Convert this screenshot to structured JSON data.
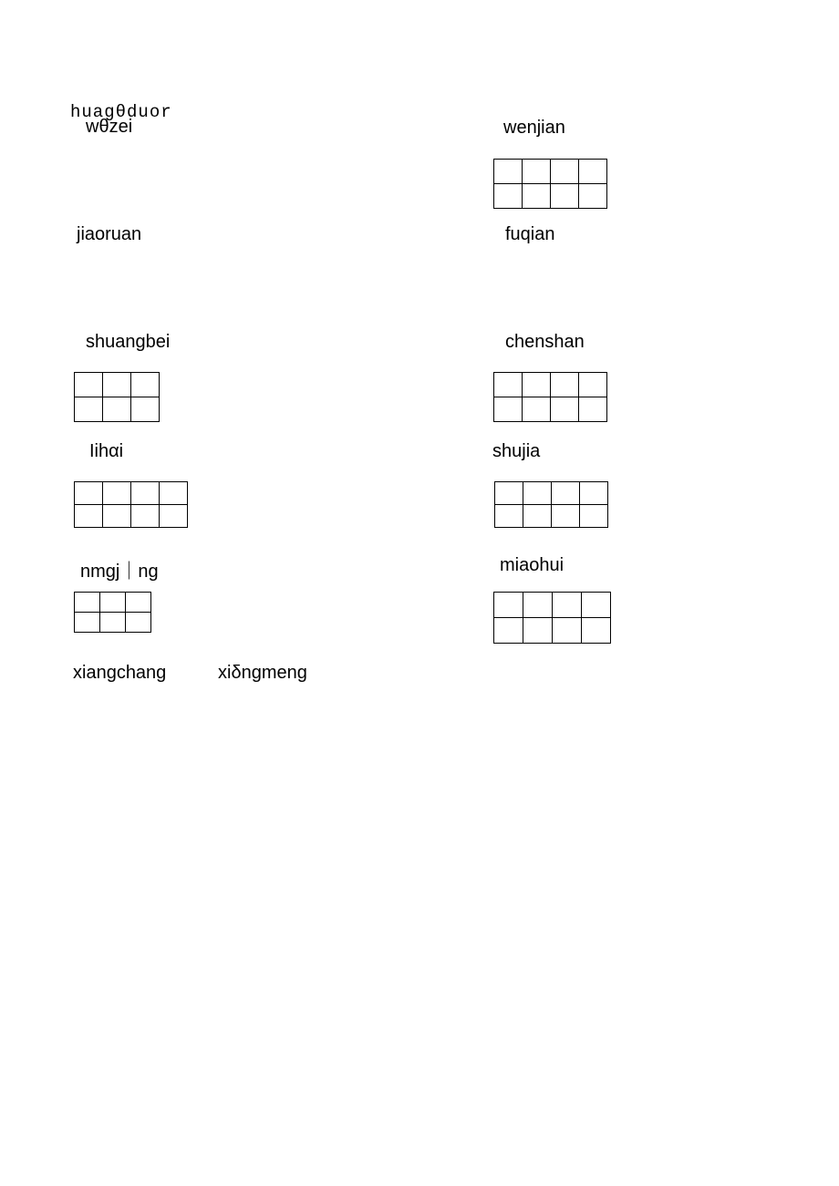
{
  "labels": {
    "huagduor": "huagθduor",
    "wzei": "wθzei",
    "wenjian": "wenjian",
    "jiaoruan": "jiaoruan",
    "fuqian": "fuqian",
    "shuangbei": "shuangbei",
    "chenshan": "chenshan",
    "lihai": "Iihαi",
    "shujia": "shujia",
    "nmgjng": "nmgj｜ng",
    "miaohui": "miaohui",
    "xiangchang": "xiangchang",
    "xidngmeng": "xiδngmeng"
  }
}
